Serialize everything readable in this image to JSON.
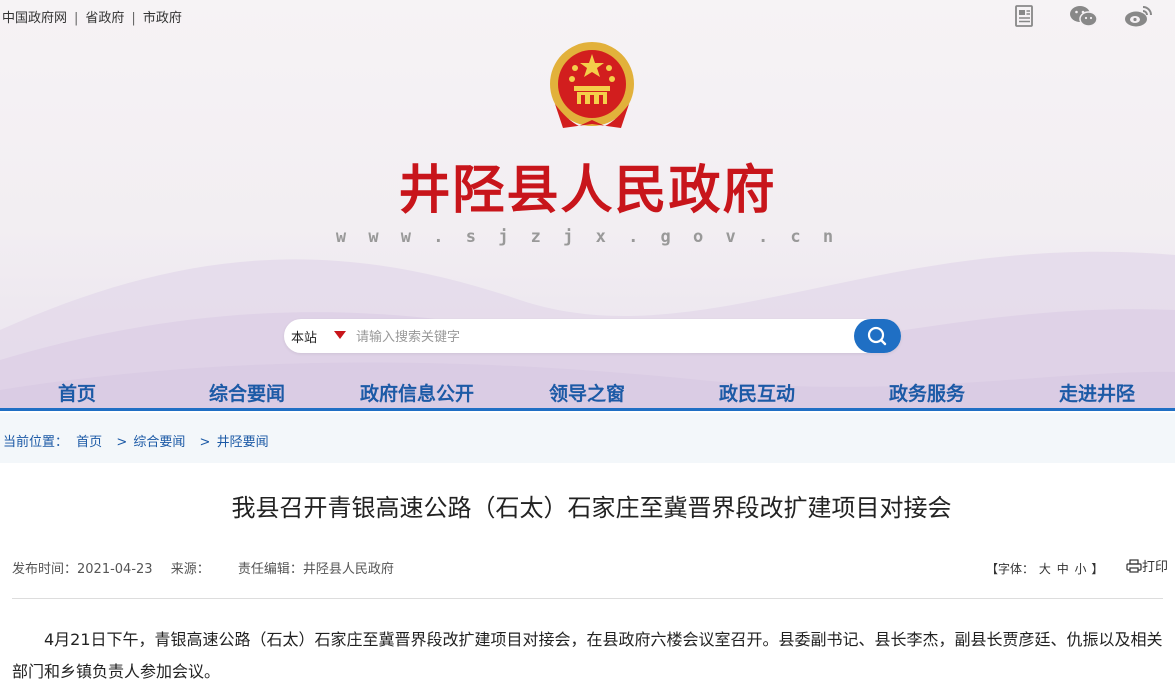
{
  "top_links": [
    "中国政府网",
    "省政府",
    "市政府"
  ],
  "top_icons": [
    "newspaper-icon",
    "wechat-icon",
    "weibo-icon"
  ],
  "site": {
    "title": "井陉县人民政府",
    "url": "w w w . s j z j x . g o v . c n",
    "emblem": "national-emblem"
  },
  "search": {
    "scope": "本站",
    "placeholder": "请输入搜索关键字",
    "button_icon": "search-icon"
  },
  "nav": [
    "首页",
    "综合要闻",
    "政府信息公开",
    "领导之窗",
    "政民互动",
    "政务服务",
    "走进井陉"
  ],
  "breadcrumb": {
    "label": "当前位置：",
    "items": [
      "首页",
      "综合要闻",
      "井陉要闻"
    ],
    "separator": ">"
  },
  "article": {
    "title": "我县召开青银高速公路（石太）石家庄至冀晋界段改扩建项目对接会",
    "date_label": "发布时间：2021-04-23",
    "source_label": "来源：",
    "editor_label": "责任编辑：井陉县人民政府",
    "font_label": "【字体：",
    "font_options": [
      "大",
      "中",
      "小"
    ],
    "font_close": "】",
    "print_label": "打印",
    "body": "4月21日下午，青银高速公路（石太）石家庄至冀晋界段改扩建项目对接会，在县政府六楼会议室召开。县委副书记、县长李杰，副县长贾彦廷、仇振以及相关部门和乡镇负责人参加会议。"
  },
  "colors": {
    "brand_red": "#c8151b",
    "nav_blue": "#1c5aa6",
    "accent_blue": "#1f6fc4"
  }
}
